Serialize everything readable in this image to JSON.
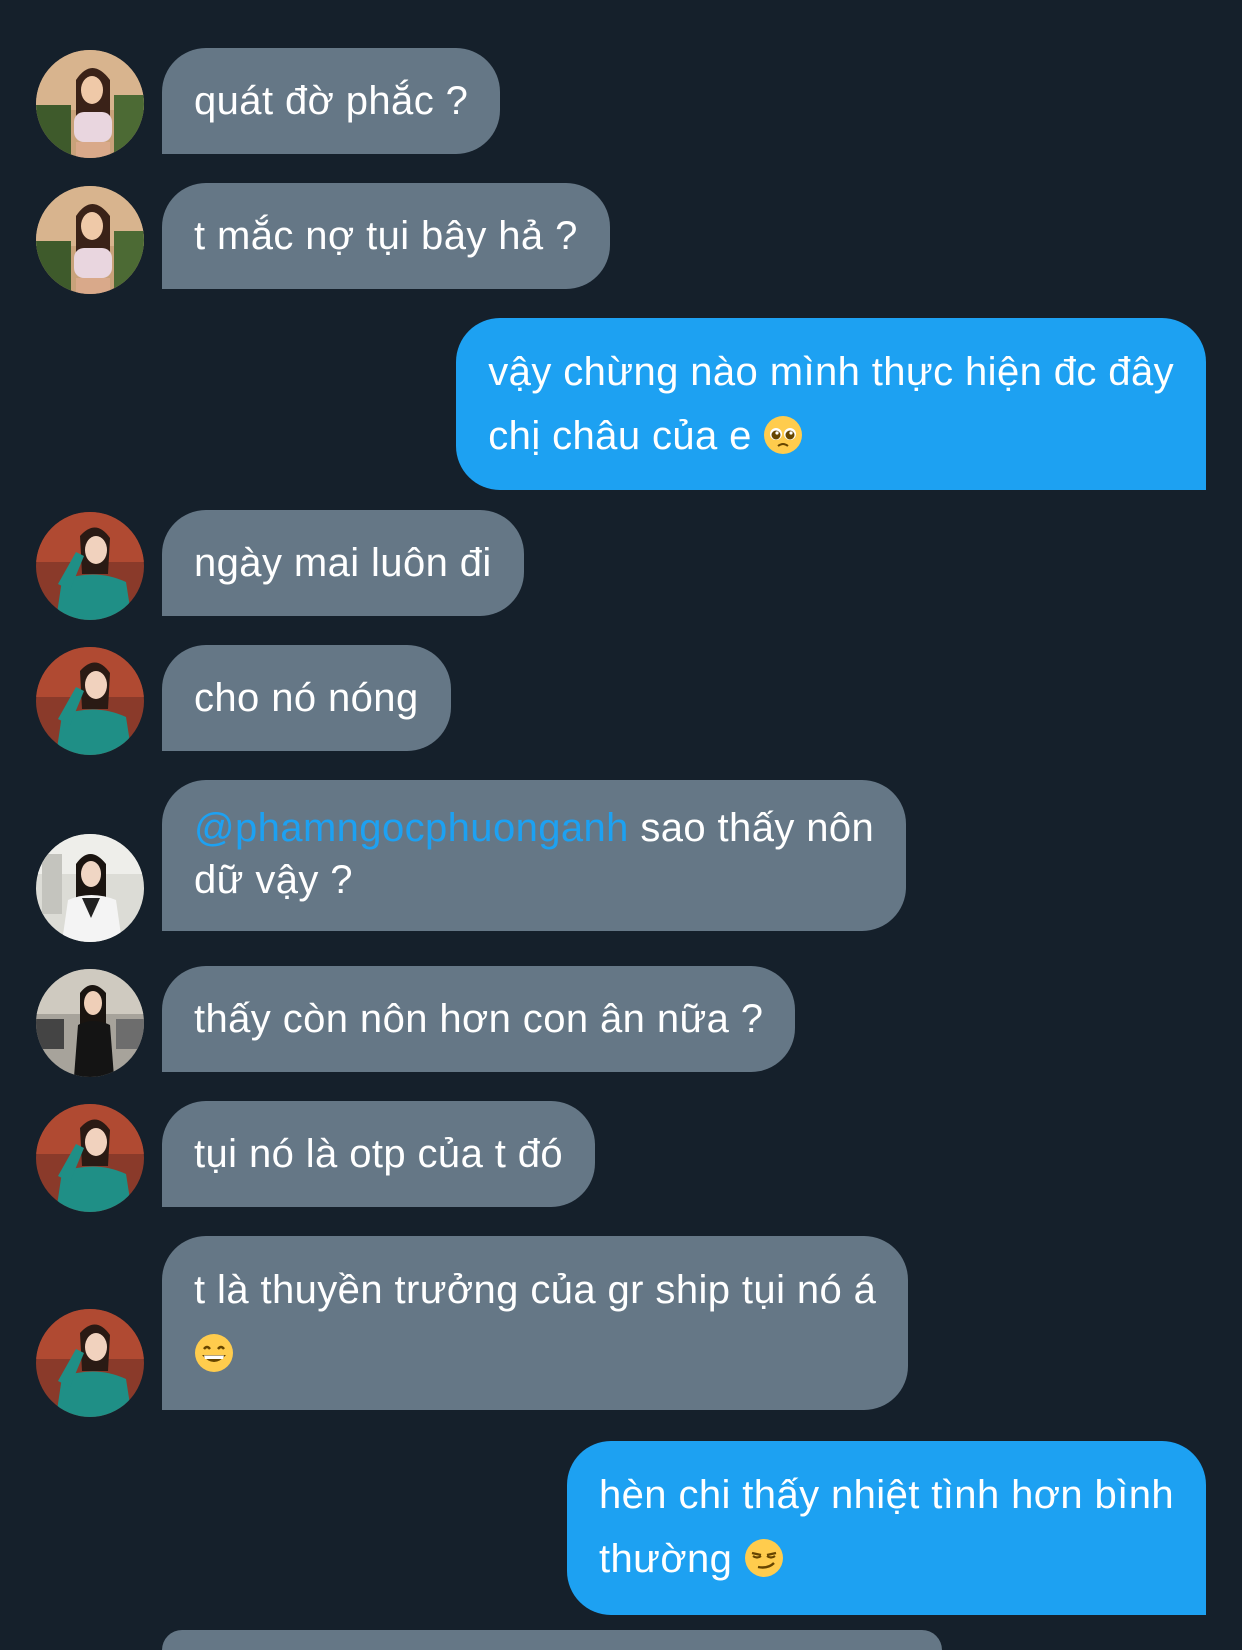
{
  "messages": [
    {
      "sender": "other",
      "text": "quát đờ phắc ?"
    },
    {
      "sender": "other",
      "text": "t mắc nợ tụi bây hả ?"
    },
    {
      "sender": "me",
      "line1": "vậy chừng nào mình thực hiện đc đây",
      "line2": "chị châu của e",
      "emoji": "pleading-face-emoji"
    },
    {
      "sender": "other",
      "text": "ngày mai luôn đi"
    },
    {
      "sender": "other",
      "text": "cho nó nóng"
    },
    {
      "sender": "other",
      "mention": "@phamngocphuonganh",
      "line1_rest": " sao thấy nôn",
      "line2": "dữ vậy ?"
    },
    {
      "sender": "other",
      "text": "thấy còn nôn hơn con ân nữa ?"
    },
    {
      "sender": "other",
      "text": "tụi nó là otp của t đó"
    },
    {
      "sender": "other",
      "line1": "t là thuyền trưởng của gr ship tụi nó á",
      "emoji": "grinning-face-emoji"
    },
    {
      "sender": "me",
      "line1": "hèn chi thấy nhiệt tình hơn bình",
      "line2": "thường",
      "emoji": "smirking-face-emoji"
    }
  ],
  "colors": {
    "background": "#15202b",
    "incoming_bubble": "#657786",
    "outgoing_bubble": "#1da1f2",
    "mention": "#1da1f2",
    "text": "#ffffff"
  }
}
